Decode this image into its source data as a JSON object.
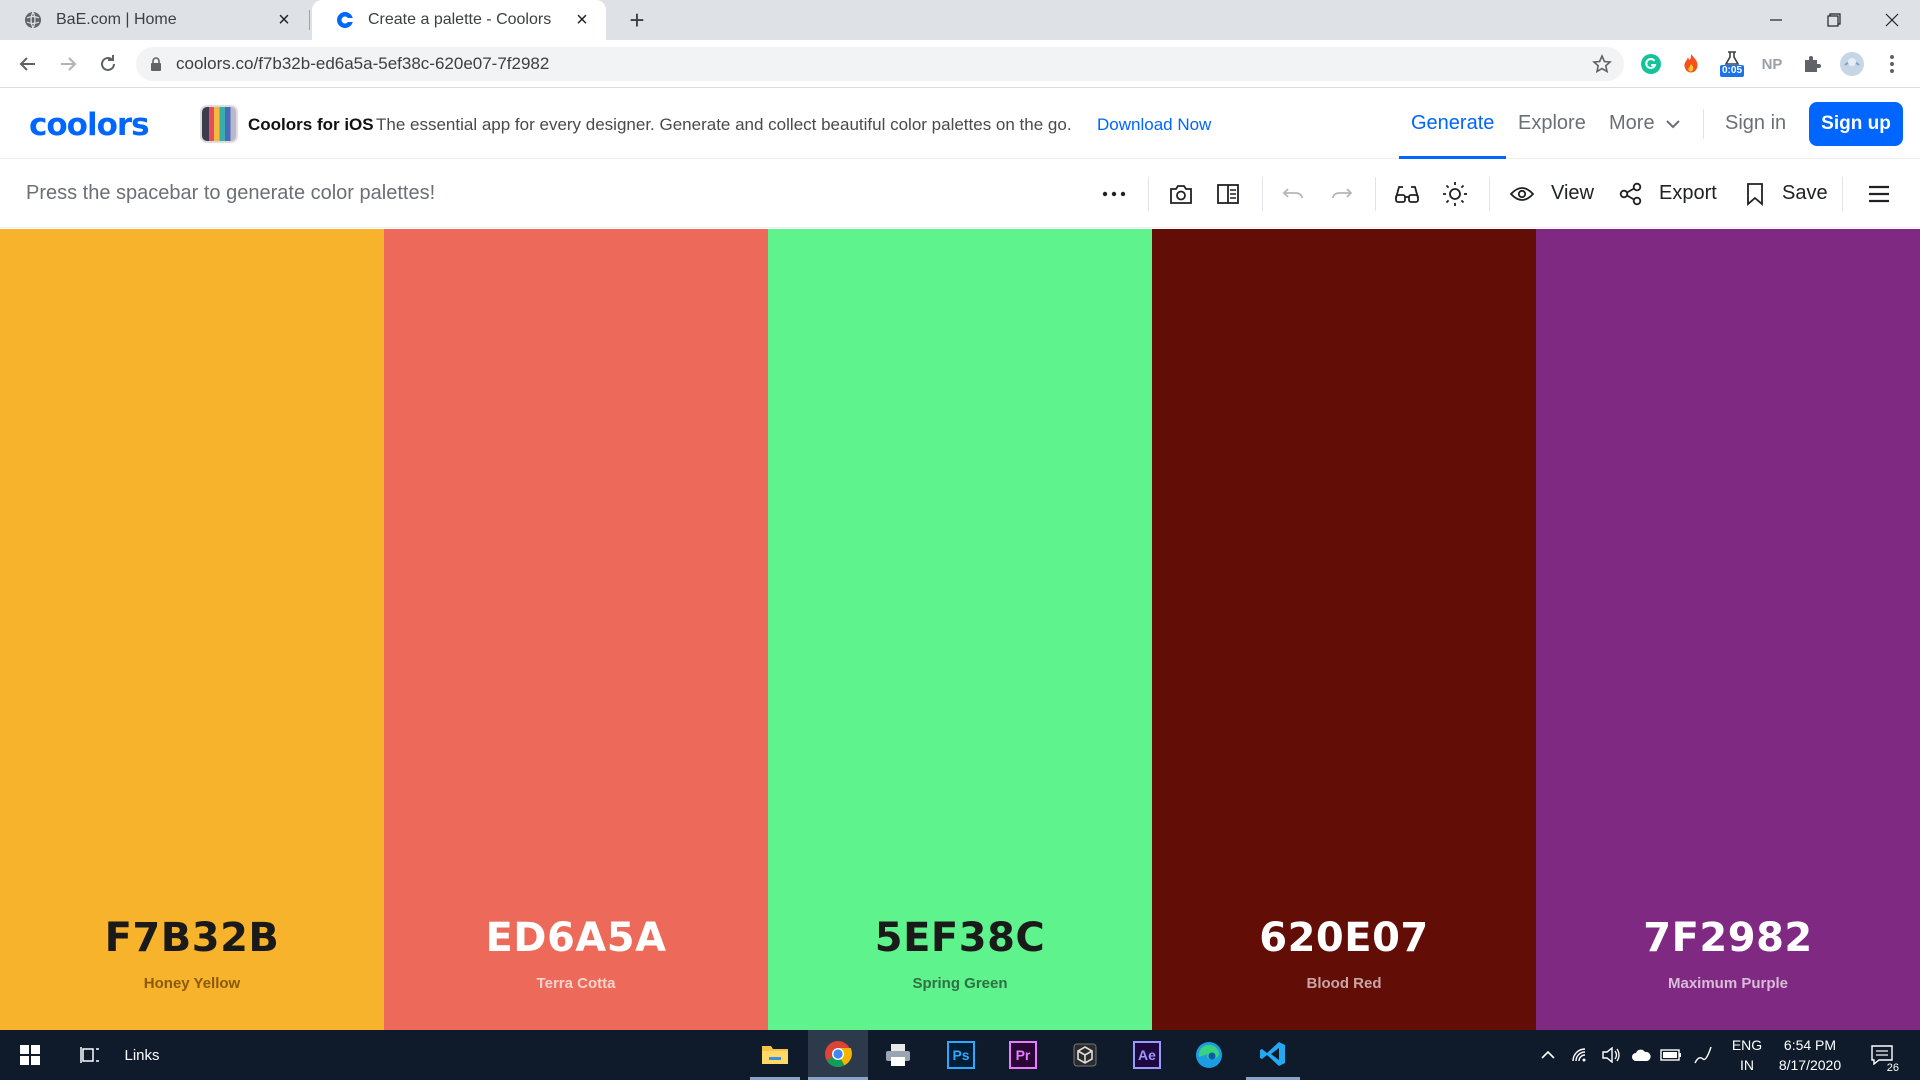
{
  "browser": {
    "tabs": [
      {
        "title": "BaE.com | Home",
        "favicon": "globe-icon"
      },
      {
        "title": "Create a palette - Coolors",
        "favicon": "coolors-icon"
      }
    ],
    "url": "coolors.co/f7b32b-ed6a5a-5ef38c-620e07-7f2982",
    "extensions": {
      "np_label": "NP",
      "timer_badge": "0:05"
    }
  },
  "site": {
    "logo": "coolors",
    "promo": {
      "title": "Coolors for iOS",
      "description": "The essential app for every designer. Generate and collect beautiful color palettes on the go.",
      "link": "Download Now"
    },
    "nav": {
      "generate": "Generate",
      "explore": "Explore",
      "more": "More",
      "sign_in": "Sign in",
      "sign_up": "Sign up"
    }
  },
  "generator": {
    "hint": "Press the spacebar to generate color palettes!",
    "view_label": "View",
    "export_label": "Export",
    "save_label": "Save"
  },
  "palette": [
    {
      "hex": "F7B32B",
      "name": "Honey Yellow",
      "color": "#F7B32B",
      "text_color": "#1a1a1a",
      "name_color": "#8a5a0c"
    },
    {
      "hex": "ED6A5A",
      "name": "Terra Cotta",
      "color": "#ED6A5A",
      "text_color": "#ffffff",
      "name_color": "#fbd3cd"
    },
    {
      "hex": "5EF38C",
      "name": "Spring Green",
      "color": "#5EF38C",
      "text_color": "#1a1a1a",
      "name_color": "#2f6f43"
    },
    {
      "hex": "620E07",
      "name": "Blood Red",
      "color": "#620E07",
      "text_color": "#ffffff",
      "name_color": "#c9a6a2"
    },
    {
      "hex": "7F2982",
      "name": "Maximum Purple",
      "color": "#7F2982",
      "text_color": "#ffffff",
      "name_color": "#d8bdd9"
    }
  ],
  "taskbar": {
    "links_label": "Links",
    "apps": [
      "file-explorer-icon",
      "chrome-icon",
      "printer-icon",
      "photoshop-icon",
      "premiere-icon",
      "unity-icon",
      "after-effects-icon",
      "edge-icon",
      "vscode-icon"
    ],
    "ps_label": "Ps",
    "pr_label": "Pr",
    "ae_label": "Ae",
    "language": "ENG",
    "region": "IN",
    "time": "6:54 PM",
    "date": "8/17/2020",
    "notification_count": "26"
  }
}
